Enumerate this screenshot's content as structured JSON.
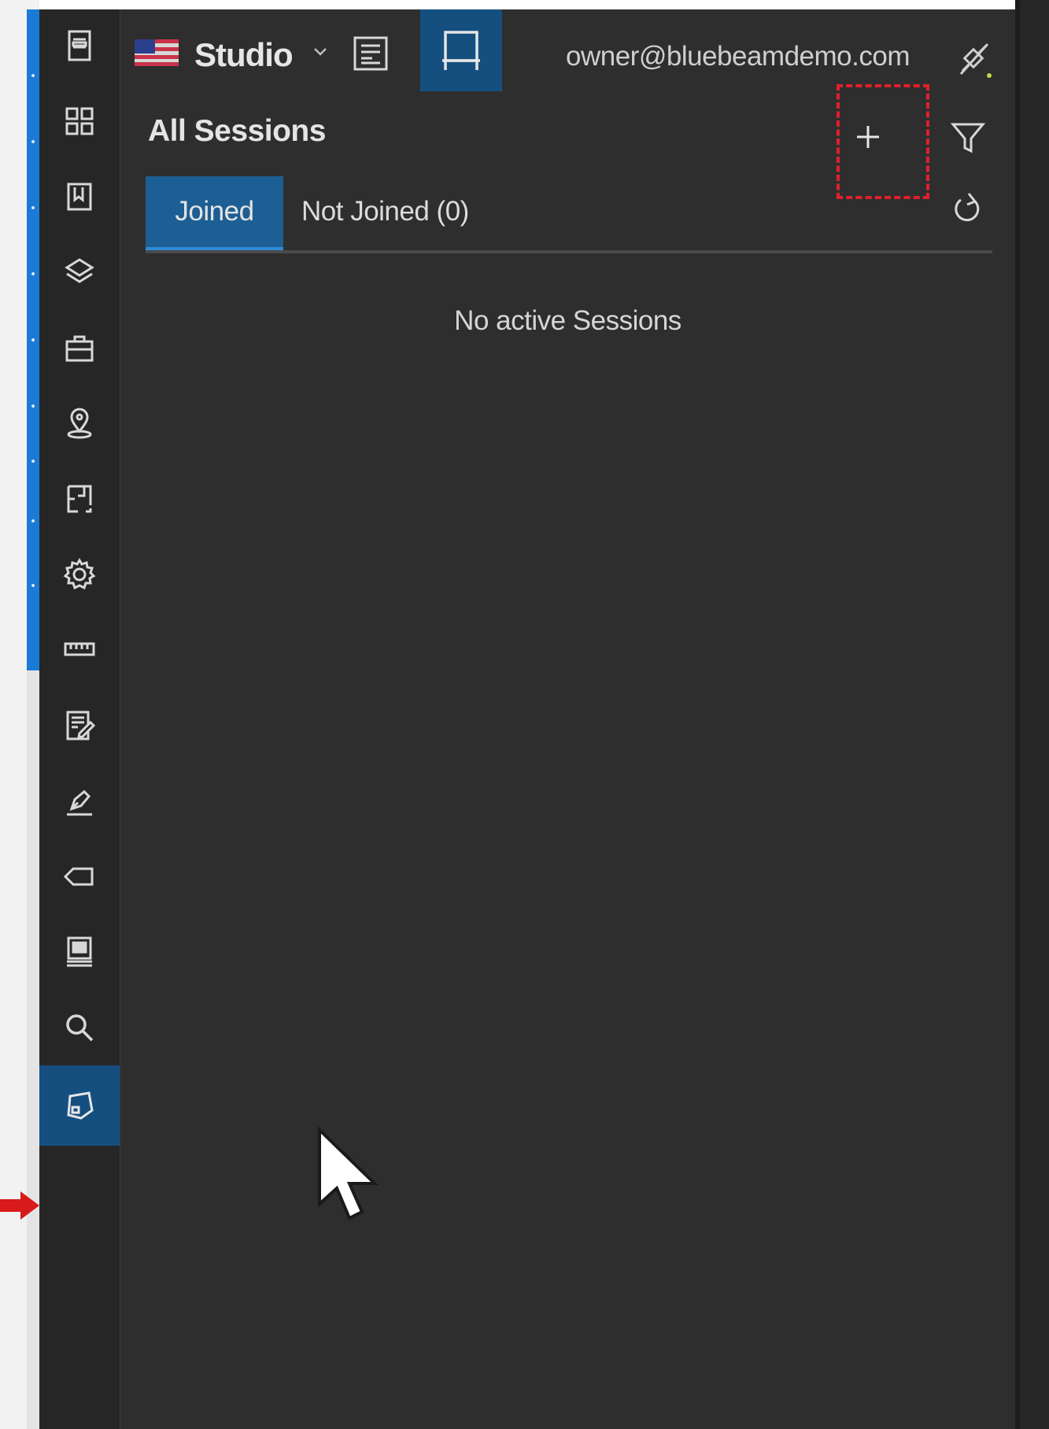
{
  "header": {
    "app_name": "Studio",
    "account_email": "owner@bluebeamdemo.com",
    "flag_icon": "us-flag-icon",
    "dropdown_icon": "chevron-down-icon",
    "documents_tab_icon": "document-list-icon",
    "studio_tab_icon": "studio-session-icon",
    "connection_icon": "plug-disconnect-icon"
  },
  "sessions": {
    "title": "All Sessions",
    "add_icon": "plus-icon",
    "filter_icon": "filter-icon",
    "refresh_icon": "refresh-icon",
    "tabs": [
      {
        "label": "Joined",
        "active": true
      },
      {
        "label": "Not Joined (0)",
        "active": false
      }
    ],
    "empty_message": "No active Sessions"
  },
  "rail": {
    "items": [
      {
        "icon": "thumbnails-icon"
      },
      {
        "icon": "grid-icon"
      },
      {
        "icon": "bookmarks-icon"
      },
      {
        "icon": "layers-icon"
      },
      {
        "icon": "toolchest-icon"
      },
      {
        "icon": "location-pin-icon"
      },
      {
        "icon": "spaces-icon"
      },
      {
        "icon": "properties-gear-icon"
      },
      {
        "icon": "measurements-ruler-icon"
      },
      {
        "icon": "markups-list-icon"
      },
      {
        "icon": "signatures-pen-icon"
      },
      {
        "icon": "tag-icon"
      },
      {
        "icon": "file-access-icon"
      },
      {
        "icon": "search-icon"
      },
      {
        "icon": "studio-icon",
        "active": true
      }
    ]
  },
  "colors": {
    "panel_bg": "#2e2e2e",
    "rail_bg": "#262626",
    "accent_blue": "#154f80",
    "highlight_red": "#e0202a"
  }
}
